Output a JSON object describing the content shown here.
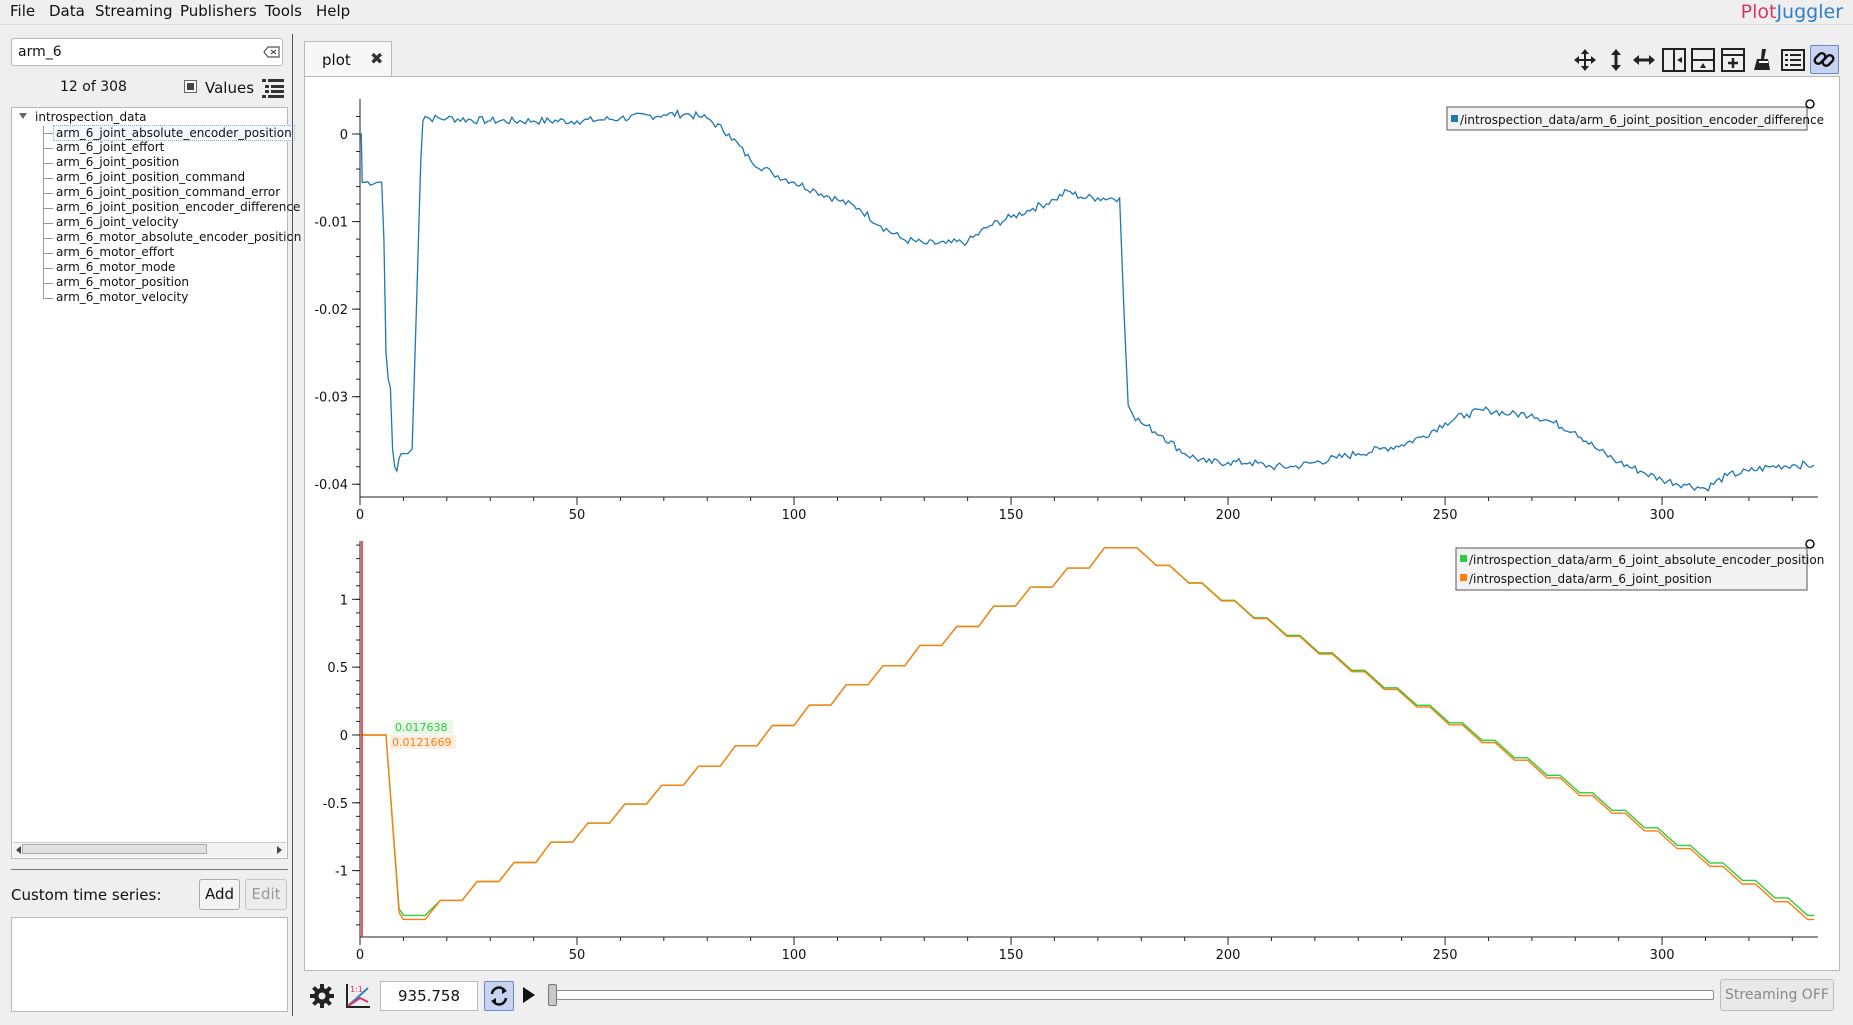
{
  "menu": {
    "items": [
      "File",
      "Data",
      "Streaming",
      "Publishers",
      "Tools",
      "Help"
    ]
  },
  "brand": {
    "part1": "Plot",
    "part2": "Juggler"
  },
  "sidebar": {
    "search_value": "arm_6",
    "count": "12 of 308",
    "values_label": "Values",
    "tree_root": "introspection_data",
    "items": [
      "arm_6_joint_absolute_encoder_position",
      "arm_6_joint_effort",
      "arm_6_joint_position",
      "arm_6_joint_position_command",
      "arm_6_joint_position_command_error",
      "arm_6_joint_position_encoder_difference",
      "arm_6_joint_velocity",
      "arm_6_motor_absolute_encoder_position",
      "arm_6_motor_effort",
      "arm_6_motor_mode",
      "arm_6_motor_position",
      "arm_6_motor_velocity"
    ],
    "custom_label": "Custom time series:",
    "add_label": "Add",
    "edit_label": "Edit"
  },
  "tabs": [
    {
      "label": "plot"
    }
  ],
  "toolbar": {
    "icons": [
      "move-icon",
      "zoom-vertical-icon",
      "zoom-horizontal-icon",
      "split-vertical-icon",
      "split-horizontal-icon",
      "add-plot-icon",
      "clear-icon",
      "legend-icon",
      "link-icon"
    ]
  },
  "playback": {
    "time": "935.758",
    "streaming_label": "Streaming OFF"
  },
  "colors": {
    "blue": "#1f77b4",
    "green": "#2ecc40",
    "orange": "#ff7f0e",
    "red": "#e02020"
  },
  "chart_data": [
    {
      "type": "line",
      "xlim": [
        0,
        335
      ],
      "ylim": [
        -0.041,
        0.004
      ],
      "xticks": [
        0,
        50,
        100,
        150,
        200,
        250,
        300
      ],
      "yticks": [
        0,
        -0.01,
        -0.02,
        -0.03,
        -0.04
      ],
      "ytick_labels": [
        "0",
        "-0.01",
        "-0.02",
        "-0.03",
        "-0.04"
      ],
      "legend_position": "top-right",
      "series": [
        {
          "name": "/introspection_data/arm_6_joint_position_encoder_difference",
          "color": "#1f77b4",
          "x": [
            0,
            0.3,
            0.5,
            5,
            5.5,
            6,
            6.5,
            7,
            7.5,
            8,
            8.5,
            9,
            9.5,
            10,
            11,
            12,
            13,
            14,
            14.5,
            15,
            16,
            20,
            30,
            40,
            50,
            55,
            60,
            70,
            75,
            78,
            80,
            85,
            90,
            95,
            100,
            105,
            110,
            115,
            120,
            125,
            130,
            135,
            140,
            145,
            150,
            155,
            160,
            163,
            166,
            170,
            175,
            176,
            177,
            178,
            180,
            185,
            190,
            195,
            200,
            205,
            210,
            215,
            220,
            225,
            230,
            235,
            240,
            245,
            250,
            255,
            260,
            265,
            270,
            275,
            280,
            285,
            290,
            295,
            300,
            305,
            310,
            315,
            320,
            325,
            330,
            335
          ],
          "y": [
            0,
            0,
            -0.0055,
            -0.0055,
            -0.012,
            -0.025,
            -0.028,
            -0.029,
            -0.036,
            -0.038,
            -0.0385,
            -0.037,
            -0.0365,
            -0.0365,
            -0.0365,
            -0.036,
            -0.02,
            -0.003,
            0.0015,
            0.002,
            0.0018,
            0.0018,
            0.0015,
            0.0015,
            0.0015,
            0.0016,
            0.0018,
            0.0022,
            0.0023,
            0.002,
            0.0018,
            0,
            -0.003,
            -0.0045,
            -0.0055,
            -0.0065,
            -0.0075,
            -0.0085,
            -0.0105,
            -0.012,
            -0.0125,
            -0.0125,
            -0.0123,
            -0.0105,
            -0.0095,
            -0.0085,
            -0.0075,
            -0.0065,
            -0.0072,
            -0.0073,
            -0.0073,
            -0.02,
            -0.031,
            -0.032,
            -0.033,
            -0.0345,
            -0.0365,
            -0.0375,
            -0.0375,
            -0.0375,
            -0.038,
            -0.038,
            -0.0375,
            -0.037,
            -0.0365,
            -0.036,
            -0.0355,
            -0.0345,
            -0.033,
            -0.032,
            -0.0315,
            -0.032,
            -0.032,
            -0.033,
            -0.034,
            -0.036,
            -0.0375,
            -0.0385,
            -0.0395,
            -0.04,
            -0.0405,
            -0.039,
            -0.0385,
            -0.038,
            -0.0378,
            -0.0378
          ]
        }
      ]
    },
    {
      "type": "line",
      "xlim": [
        0,
        335
      ],
      "ylim": [
        -1.46,
        1.43
      ],
      "xticks": [
        0,
        50,
        100,
        150,
        200,
        250,
        300
      ],
      "yticks": [
        1,
        0.5,
        0,
        -0.5,
        -1
      ],
      "ytick_labels": [
        "1",
        "0.5",
        "0",
        "-0.5",
        "-1"
      ],
      "legend_position": "top-right",
      "tracker_values": [
        "0.017638",
        "0.0121669"
      ],
      "series": [
        {
          "name": "/introspection_data/arm_6_joint_absolute_encoder_position",
          "color": "#2ecc40",
          "step_values_up": [
            -1.33,
            -1.22,
            -1.08,
            -0.94,
            -0.79,
            -0.65,
            -0.51,
            -0.37,
            -0.23,
            -0.08,
            0.07,
            0.22,
            0.37,
            0.51,
            0.66,
            0.8,
            0.95,
            1.09,
            1.23,
            1.38
          ],
          "peak": 1.38,
          "final": -1.33
        },
        {
          "name": "/introspection_data/arm_6_joint_position",
          "color": "#ff7f0e",
          "step_values_up": [
            -1.36,
            -1.22,
            -1.08,
            -0.94,
            -0.79,
            -0.65,
            -0.51,
            -0.37,
            -0.23,
            -0.08,
            0.07,
            0.22,
            0.37,
            0.51,
            0.66,
            0.8,
            0.95,
            1.09,
            1.23,
            1.38
          ],
          "peak": 1.38,
          "final": -1.36
        }
      ]
    }
  ]
}
